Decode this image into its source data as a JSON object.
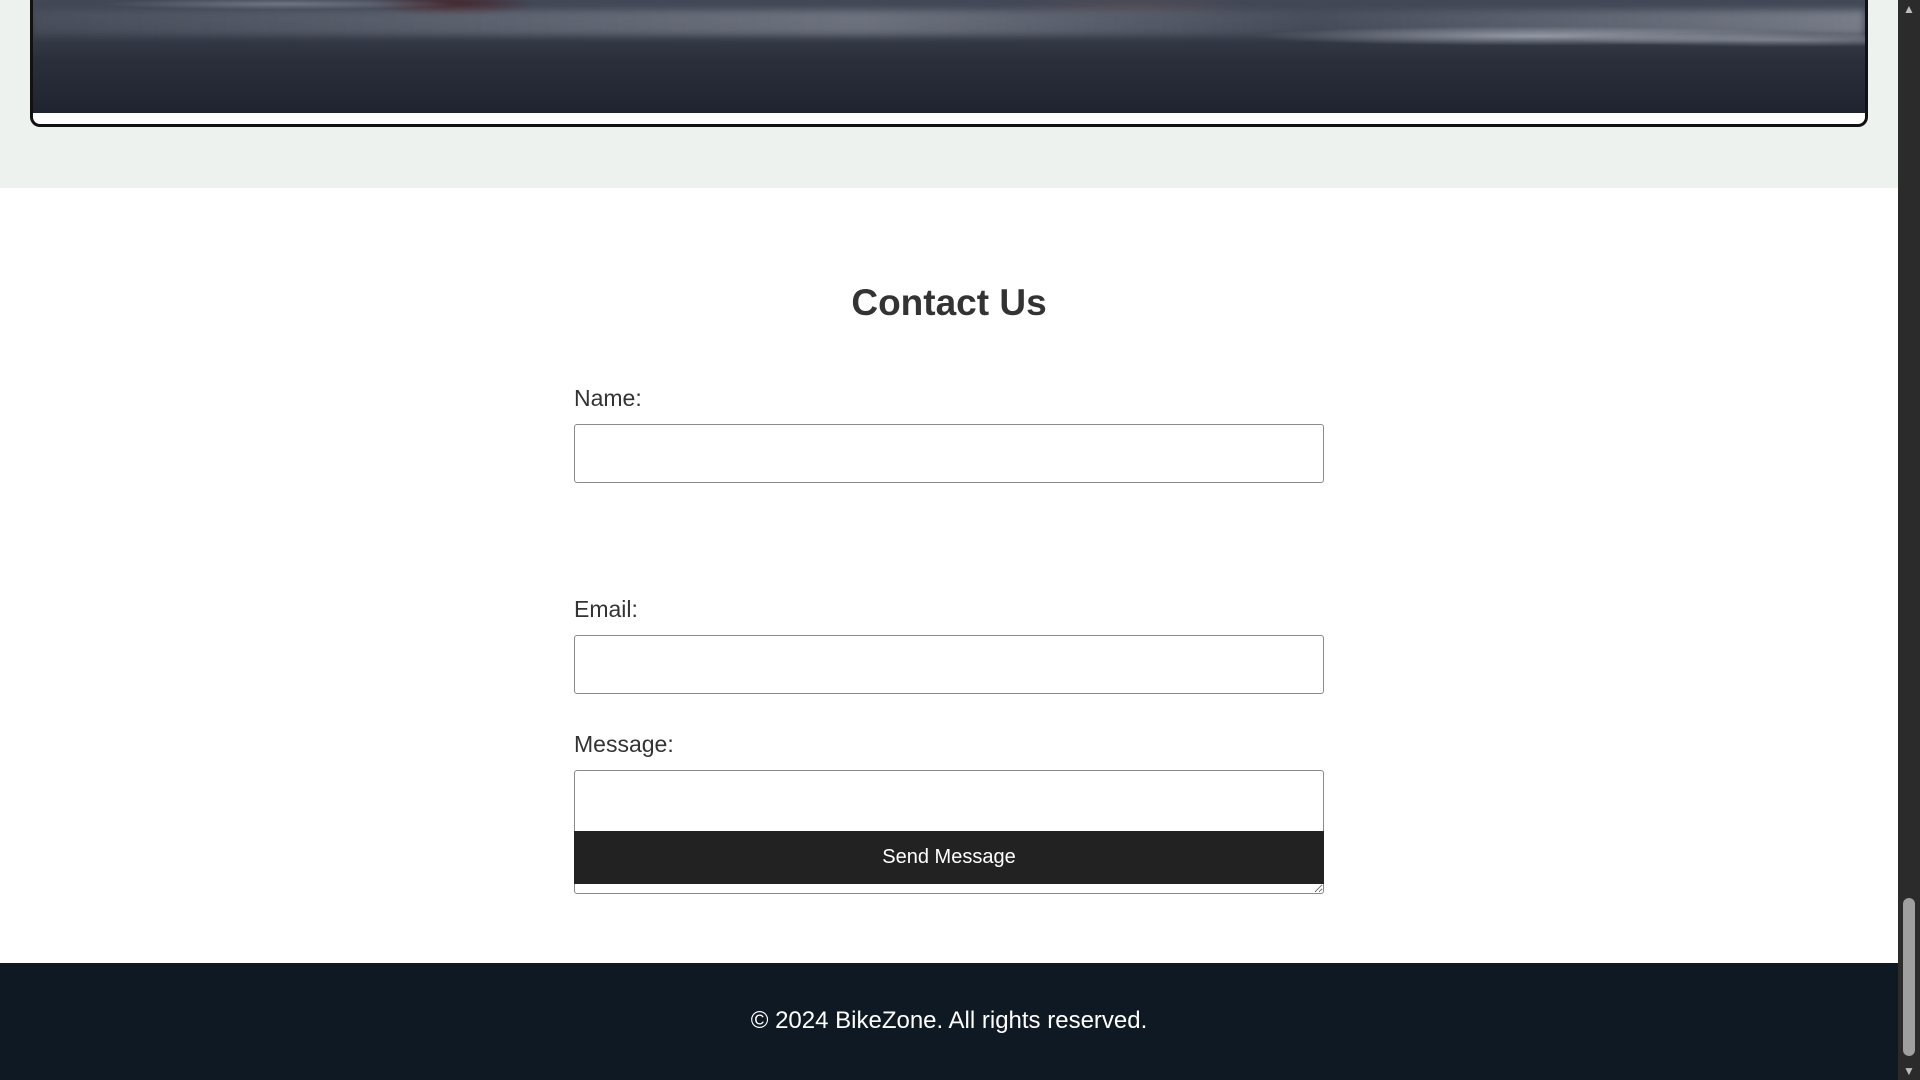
{
  "gallery": {
    "image_alt": "Bike on the shore at dusk"
  },
  "contact": {
    "title": "Contact Us",
    "name_label": "Name:",
    "name_value": "",
    "email_label": "Email:",
    "email_value": "",
    "message_label": "Message:",
    "message_value": "",
    "submit_label": "Send Message"
  },
  "footer": {
    "copyright": "© 2024 BikeZone. All rights reserved."
  },
  "scrollbar": {
    "up_arrow": "▲",
    "down_arrow": "▼"
  },
  "colors": {
    "page_background": "#ffffff",
    "gallery_section_background": "#eef2ee",
    "button_background": "#222222",
    "footer_background": "#0f1923",
    "text": "#333333"
  }
}
